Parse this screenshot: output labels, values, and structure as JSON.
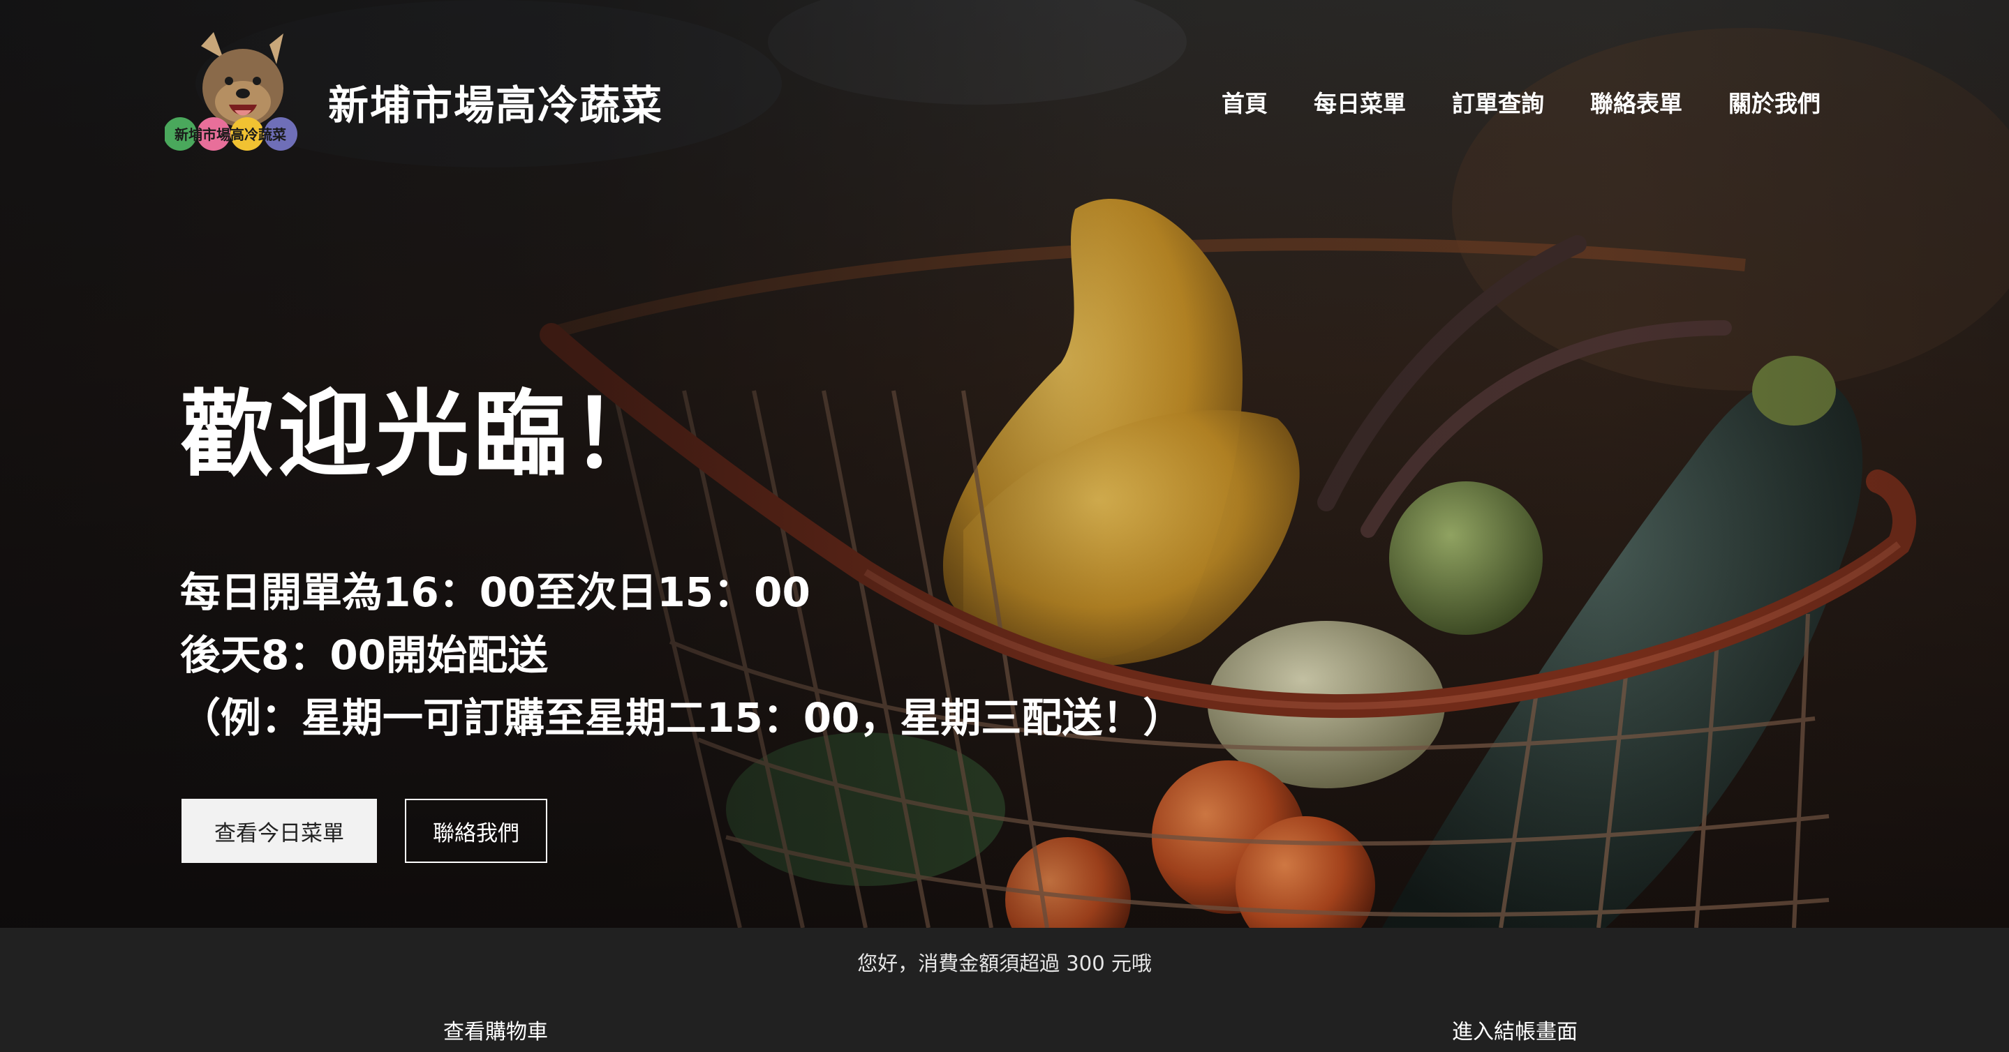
{
  "site": {
    "title": "新埔市場高冷蔬菜",
    "logo_icon": "dog-logo-icon",
    "logo_text": "新埔市場高冷蔬菜"
  },
  "nav": {
    "items": [
      {
        "label": "首頁"
      },
      {
        "label": "每日菜單"
      },
      {
        "label": "訂單查詢"
      },
      {
        "label": "聯絡表單"
      },
      {
        "label": "關於我們"
      }
    ]
  },
  "hero": {
    "heading": "歡迎光臨！",
    "lines": [
      "每日開單為16：00至次日15：00",
      "後天8：00開始配送",
      "（例：星期一可訂購至星期二15：00，星期三配送！）"
    ],
    "primary_button": "查看今日菜單",
    "secondary_button": "聯絡我們",
    "background": "vegetable-basket-photo"
  },
  "cart_bar": {
    "notice": "您好，消費金額須超過 300 元哦",
    "view_cart": "查看購物車",
    "checkout": "進入結帳畫面"
  },
  "colors": {
    "bar_background": "#212121",
    "primary_button_bg": "#f2f2f2",
    "text_light": "#ffffff"
  }
}
